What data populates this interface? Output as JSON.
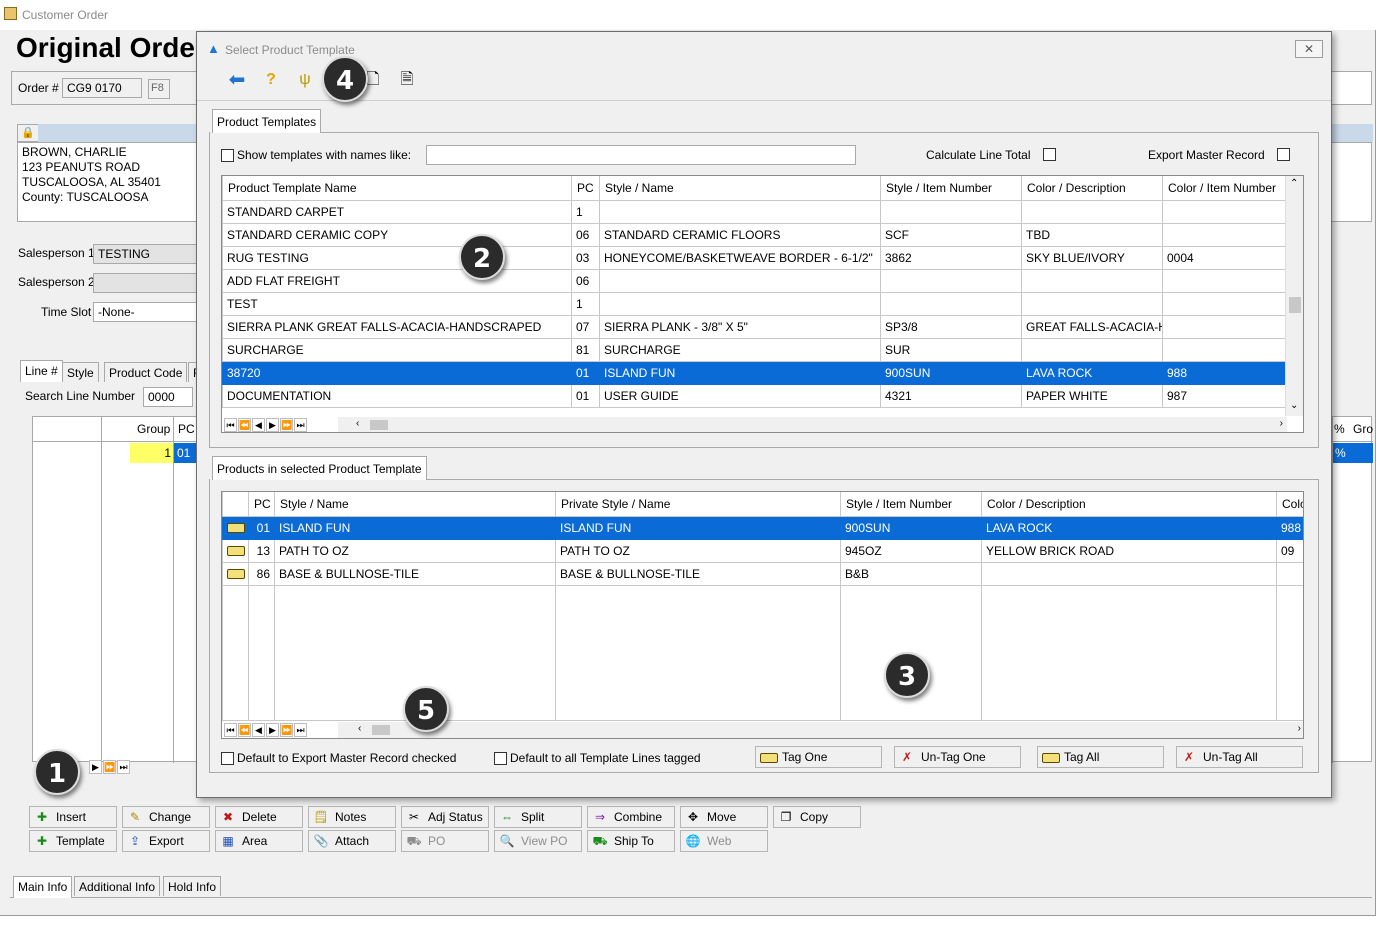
{
  "app": {
    "window_title": "Customer Order",
    "page_title": "Original Orde",
    "order_label": "Order #",
    "order_value": "CG9 0170",
    "f8_label": "F8"
  },
  "customer": {
    "lines": [
      "BROWN, CHARLIE",
      "123 PEANUTS ROAD",
      "TUSCALOOSA, AL  35401",
      "County: TUSCALOOSA"
    ]
  },
  "salesperson": {
    "sp1_label": "Salesperson 1",
    "sp1_value": "TESTING",
    "sp2_label": "Salesperson 2",
    "sp2_value": "",
    "timeslot_label": "Time Slot",
    "timeslot_value": "-None-"
  },
  "line_tabs": [
    "Line #",
    "Style",
    "Product Code",
    "F"
  ],
  "search_line": {
    "label": "Search Line Number",
    "value": "0000"
  },
  "line_grid": {
    "headers": [
      "Group",
      "PC"
    ],
    "row": {
      "group": "1",
      "pc": "01"
    },
    "right_headers": [
      "%",
      "Gro"
    ],
    "right_row": "%"
  },
  "buttons_row1": [
    {
      "label": "Insert",
      "icon": "insert-icon"
    },
    {
      "label": "Change",
      "icon": "change-icon"
    },
    {
      "label": "Delete",
      "icon": "delete-icon"
    },
    {
      "label": "Notes",
      "icon": "notes-icon"
    },
    {
      "label": "Adj Status",
      "icon": "adjust-icon"
    },
    {
      "label": "Split",
      "icon": "split-icon"
    },
    {
      "label": "Combine",
      "icon": "combine-icon"
    },
    {
      "label": "Move",
      "icon": "move-icon"
    },
    {
      "label": "Copy",
      "icon": "copy-icon"
    }
  ],
  "buttons_row2": [
    {
      "label": "Template",
      "icon": "template-icon"
    },
    {
      "label": "Export",
      "icon": "export-icon"
    },
    {
      "label": "Area",
      "icon": "area-icon"
    },
    {
      "label": "Attach",
      "icon": "attach-icon"
    },
    {
      "label": "PO",
      "icon": "truck-icon"
    },
    {
      "label": "View PO",
      "icon": "magnifier-icon"
    },
    {
      "label": "Ship To",
      "icon": "ship-icon"
    },
    {
      "label": "Web",
      "icon": "web-icon"
    }
  ],
  "bottom_tabs": [
    "Main Info",
    "Additional Info",
    "Hold Info"
  ],
  "dialog": {
    "title": "Select Product Template",
    "close": "✕",
    "templates_tab": "Product Templates",
    "show_names_label": "Show templates with names like:",
    "show_names_value": "",
    "calc_total_label": "Calculate Line Total",
    "export_master_label": "Export Master Record",
    "templates_headers": [
      "Product Template Name",
      "PC",
      "Style / Name",
      "Style / Item Number",
      "Color / Description",
      "Color / Item Number"
    ],
    "templates_rows": [
      [
        "STANDARD CARPET",
        "1",
        "",
        "",
        "",
        ""
      ],
      [
        "STANDARD CERAMIC COPY",
        "06",
        "STANDARD CERAMIC FLOORS",
        "SCF",
        "TBD",
        ""
      ],
      [
        "RUG TESTING",
        "03",
        "HONEYCOME/BASKETWEAVE BORDER - 6-1/2\"",
        "3862",
        "SKY BLUE/IVORY",
        "0004"
      ],
      [
        "ADD FLAT FREIGHT",
        "06",
        "",
        "",
        "",
        ""
      ],
      [
        "TEST",
        "1",
        "",
        "",
        "",
        ""
      ],
      [
        "SIERRA PLANK GREAT FALLS-ACACIA-HANDSCRAPED",
        "07",
        "SIERRA PLANK - 3/8\" X 5\"",
        "SP3/8",
        "GREAT FALLS-ACACIA-HA",
        ""
      ],
      [
        "SURCHARGE",
        "81",
        "SURCHARGE",
        "SUR",
        "",
        ""
      ],
      [
        "38720",
        "01",
        "ISLAND FUN",
        "900SUN",
        "LAVA ROCK",
        "988"
      ],
      [
        "DOCUMENTATION",
        "01",
        "USER GUIDE",
        "4321",
        "PAPER WHITE",
        "987"
      ]
    ],
    "templates_selected_index": 7,
    "products_tab": "Products in selected Product Template",
    "products_headers": [
      "PC",
      "Style / Name",
      "Private Style / Name",
      "Style / Item Number",
      "Color / Description",
      "Colo"
    ],
    "products_rows": [
      [
        "01",
        "ISLAND FUN",
        "ISLAND FUN",
        "900SUN",
        "LAVA ROCK",
        "988"
      ],
      [
        "13",
        "PATH TO OZ",
        "PATH TO OZ",
        "945OZ",
        "YELLOW BRICK ROAD",
        "09"
      ],
      [
        "86",
        "BASE & BULLNOSE-TILE",
        "BASE & BULLNOSE-TILE",
        "B&B",
        "",
        ""
      ]
    ],
    "products_selected_index": 0,
    "default_export_label": "Default to Export Master Record checked",
    "default_tagged_label": "Default to all Template Lines tagged",
    "tag_buttons": [
      "Tag One",
      "Un-Tag One",
      "Tag All",
      "Un-Tag All"
    ]
  },
  "callouts": [
    "1",
    "2",
    "3",
    "4",
    "5"
  ],
  "colors": {
    "selection": "#0a6bd6",
    "group_cell": "#ffff66",
    "header_band": "#c9d9ea"
  }
}
